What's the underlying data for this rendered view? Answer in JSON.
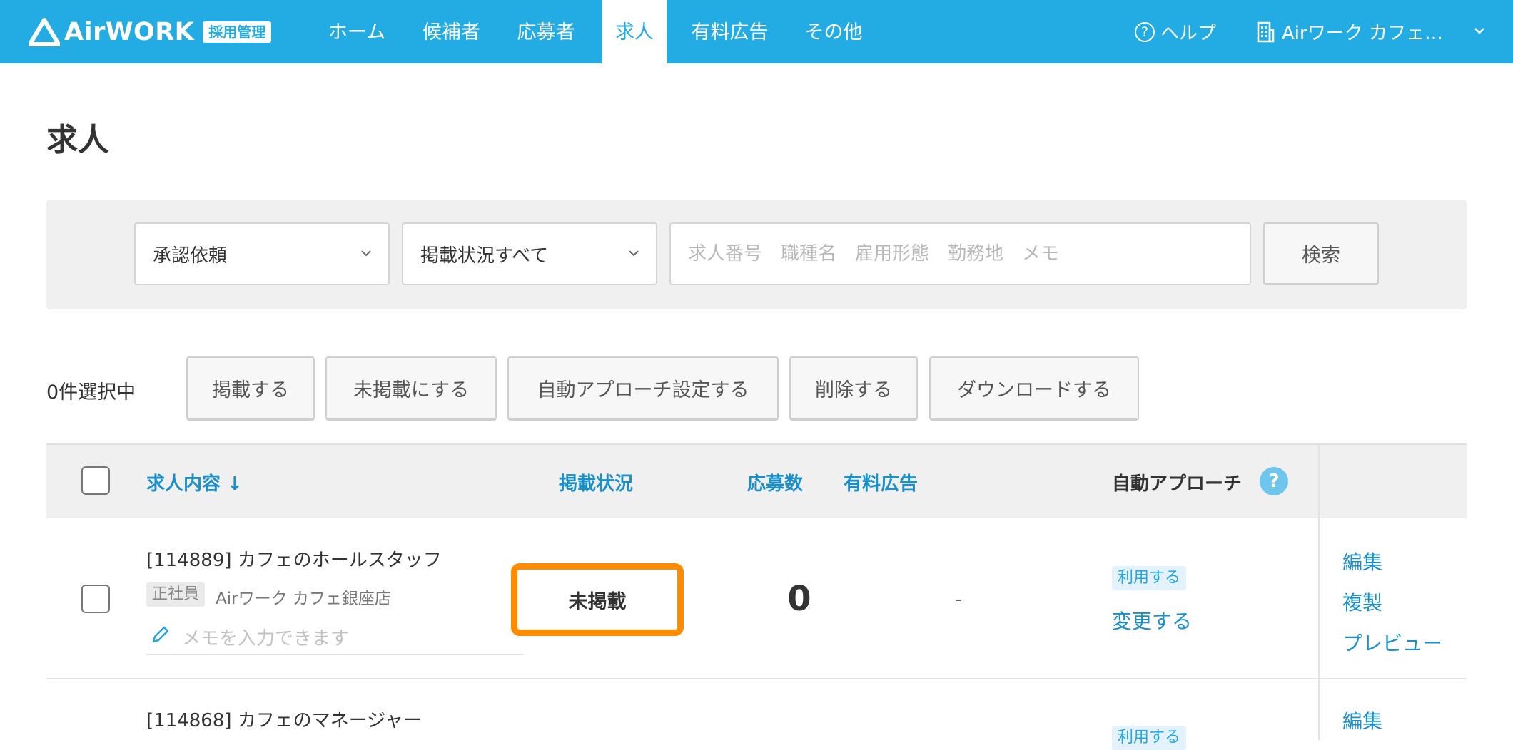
{
  "app": {
    "logo_text": "AirWORK",
    "logo_badge": "採用管理"
  },
  "nav": {
    "items": [
      {
        "label": "ホーム"
      },
      {
        "label": "候補者"
      },
      {
        "label": "応募者"
      },
      {
        "label": "求人",
        "active": true
      },
      {
        "label": "有料広告"
      },
      {
        "label": "その他"
      }
    ],
    "help_label": "ヘルプ",
    "account_label": "Airワーク カフェ…",
    "icons": {
      "help": "question-circle-icon",
      "account": "building-icon",
      "dropdown": "chevron-down-icon"
    }
  },
  "page": {
    "title": "求人"
  },
  "filters": {
    "approval_select": "承認依頼",
    "status_select": "掲載状況すべて",
    "search_placeholder": "求人番号　職種名　雇用形態　勤務地　メモ",
    "search_value": "",
    "search_button": "検索"
  },
  "bulk_actions": {
    "selected_count": "0件選択中",
    "buttons": [
      {
        "label": "掲載する"
      },
      {
        "label": "未掲載にする"
      },
      {
        "label": "自動アプローチ設定する"
      },
      {
        "label": "削除する"
      },
      {
        "label": "ダウンロードする"
      }
    ]
  },
  "table": {
    "headers": {
      "content": "求人内容 ↓",
      "status": "掲載状況",
      "applications": "応募数",
      "paid_ad": "有料広告",
      "auto_approach": "自動アプローチ",
      "help_mark": "?"
    },
    "rows": [
      {
        "title": "[114889] カフェのホールスタッフ",
        "employment_type": "正社員",
        "shop": "Airワーク カフェ銀座店",
        "memo_placeholder": "メモを入力できます",
        "status": "未掲載",
        "applications": "0",
        "paid_ad": "-",
        "auto_approach_badge": "利用する",
        "auto_approach_change": "変更する",
        "actions": [
          "編集",
          "複製",
          "プレビュー"
        ]
      },
      {
        "title": "[114868] カフェのマネージャー",
        "auto_approach_badge": "利用する",
        "actions": [
          "編集"
        ]
      }
    ]
  },
  "colors": {
    "brand": "#23ace3",
    "link": "#1a8fc9",
    "highlight": "#ff8c00"
  }
}
